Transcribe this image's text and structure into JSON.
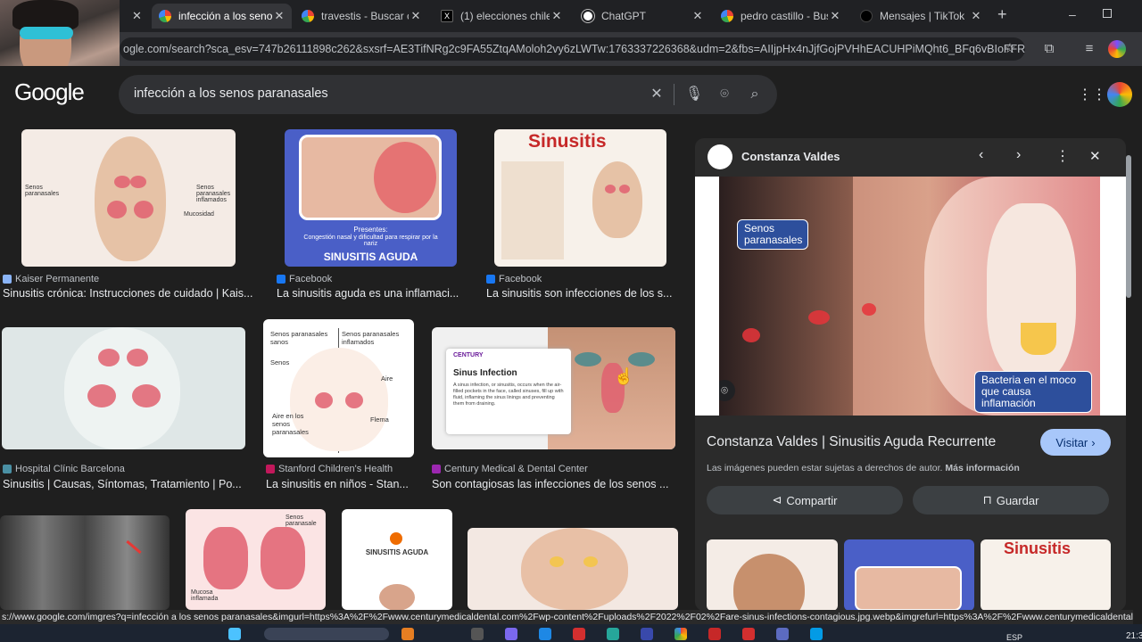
{
  "tabs": [
    {
      "label": "infección a los senos",
      "icon": "google-icon",
      "active": true
    },
    {
      "label": "travestis - Buscar co",
      "icon": "google-icon",
      "active": false
    },
    {
      "label": "(1) elecciones chile -",
      "icon": "x-icon",
      "active": false
    },
    {
      "label": "ChatGPT",
      "icon": "chatgpt-icon",
      "active": false
    },
    {
      "label": "pedro castillo - Busc",
      "icon": "google-icon",
      "active": false
    },
    {
      "label": "Mensajes | TikTok",
      "icon": "tiktok-icon",
      "active": false
    }
  ],
  "new_tab": "+",
  "address": {
    "url": "ogle.com/search?sca_esv=747b26111898c262&sxsrf=AE3TifNRg2c9FA55ZtqAMoloh2vy6zLWTw:1763337226368&udm=2&fbs=AIIjpHx4nJjfGojPVHhEACUHPiMQht6_BFq6vBIoFFRK7qc..."
  },
  "google": {
    "logo": "Google",
    "query": "infección a los senos paranasales"
  },
  "results": [
    {
      "source": "Kaiser Permanente",
      "title": "Sinusitis crónica: Instrucciones de cuidado | Kais...",
      "labels": [
        "Senos paranasales",
        "Senos paranasales inflamados",
        "Mucosidad"
      ]
    },
    {
      "source": "Facebook",
      "title": "La sinusitis aguda es una inflamaci...",
      "labels": [
        "Presentes:",
        "Congestión nasal y dificultad para respirar por la nariz",
        "SINUSITIS AGUDA"
      ]
    },
    {
      "source": "Facebook",
      "title": "La sinusitis son infecciones de los s...",
      "labels": [
        "Sinusitis"
      ]
    },
    {
      "source": "Hospital Clínic Barcelona",
      "title": "Sinusitis | Causas, Síntomas, Tratamiento | Po...",
      "labels": []
    },
    {
      "source": "Stanford Children's Health",
      "title": "La sinusitis en niños - Stan...",
      "labels": [
        "Senos paranasales sanos",
        "Senos paranasales inflamados",
        "Senos",
        "Aire",
        "Aire en los senos paranasales",
        "Flema"
      ]
    },
    {
      "source": "Century Medical & Dental Center",
      "title": "Son contagiosas las infecciones de los senos ...",
      "labels": [
        "CENTURY",
        "Sinus Infection",
        "A sinus infection, or sinusitis, occurs when the air-filled pockets in the face, called sinuses, fill up with fluid, inflaming the sinus linings and preventing them from draining."
      ]
    },
    {
      "source": "",
      "title": "",
      "labels": []
    },
    {
      "source": "",
      "title": "",
      "labels": [
        "Senos paranasale",
        "Mucosa inflamada"
      ]
    },
    {
      "source": "",
      "title": "",
      "labels": [
        "SINUSITIS AGUDA"
      ]
    },
    {
      "source": "",
      "title": "",
      "labels": []
    }
  ],
  "panel": {
    "source": "Constanza Valdes",
    "image_labels": {
      "senos": "Senos paranasales",
      "bacteria": "Bacteria en el moco que causa inflamación"
    },
    "title": "Constanza Valdes | Sinusitis Aguda Recurrente",
    "visit": "Visitar",
    "copyright": "Las imágenes pueden estar sujetas a derechos de autor.",
    "more_info": "Más información",
    "share": "Compartir",
    "save": "Guardar",
    "related_label": "Sinusitis"
  },
  "status_url": "s://www.google.com/imgres?q=infección a los senos paranasales&imgurl=https%3A%2F%2Fwww.centurymedicaldental.com%2Fwp-content%2Fuploads%2F2022%2F02%2Fare-sinus-infections-contagious.jpg.webp&imgrefurl=https%3A%2F%2Fwww.centurymedicaldental.com...",
  "taskbar": {
    "lang": "ESP",
    "time": "21:3"
  },
  "colors": {
    "accent": "#a8c7fa",
    "bg": "#1f1f1f",
    "panel": "#2b2b2b"
  }
}
